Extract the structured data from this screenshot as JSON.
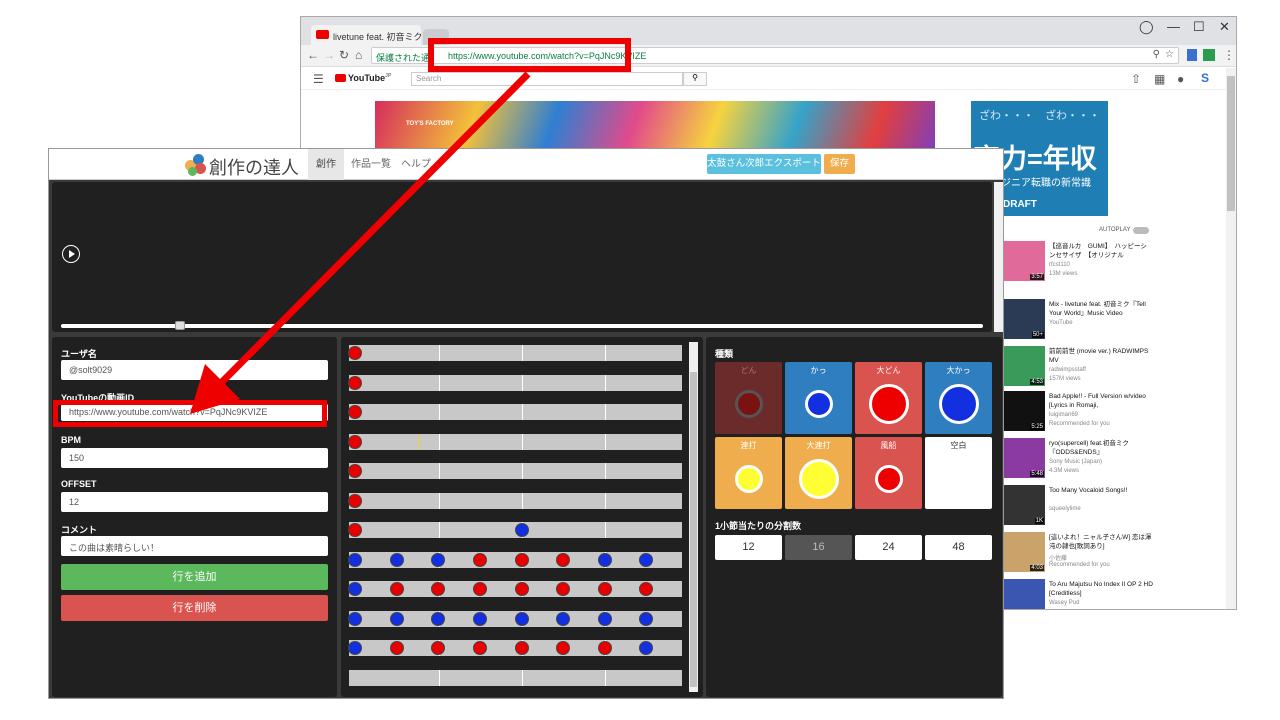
{
  "browser": {
    "tab_title": "livetune feat. 初音ミク『Te",
    "window_controls": [
      "◯",
      "—",
      "☐",
      "✕"
    ],
    "secure_label": "保護された通",
    "url": "https://www.youtube.com/watch?v=PqJNc9KVIZE",
    "search_placeholder": "Search",
    "youtube_logo": "YouTube",
    "youtube_region": "JP",
    "banner_brand": "TOY'S FACTORY",
    "ad": {
      "deco": "ざわ・・・　ざわ・・・",
      "title": "実力=年収",
      "subtitle": "エンジニア転職の新常識",
      "brand": "転職DRAFT"
    },
    "autoplay_label": "AUTOPLAY",
    "recommendations": [
      {
        "title": "【巡音ルカ　GUMI】　ハッピーシンセサイザ　【オリジナル",
        "channel": "rfcst110",
        "meta": "13M views",
        "duration": "3:57",
        "color": "#e06b9a"
      },
      {
        "title": "Mix - livetune feat. 初音ミク『Tell Your World』Music Video",
        "channel": "YouTube",
        "meta": "",
        "duration": "50+",
        "color": "#2b3a55"
      },
      {
        "title": "前前前世 (movie ver.) RADWIMPS MV",
        "channel": "radwimpsstaff",
        "meta": "157M views",
        "duration": "4:53",
        "color": "#3a9a5a"
      },
      {
        "title": "Bad Apple!! - Full Version w/video [Lyrics in Romaji,",
        "channel": "luigiman69",
        "meta": "Recommended for you",
        "duration": "5:25",
        "color": "#111111"
      },
      {
        "title": "ryo(supercell) feat.初音ミク『ODDS&ENDS』",
        "channel": "Sony Music (Japan)",
        "meta": "4.3M views",
        "duration": "5:48",
        "color": "#8a3aa0"
      },
      {
        "title": "Too Many Vocaloid Songs!!",
        "channel": "squeelylime",
        "meta": "",
        "duration": "1K",
        "color": "#333333"
      },
      {
        "title": "[這いよれ！ニャル子さんW] 恋は渾沌の隷也[歌詞あり]",
        "channel": "小佐藤",
        "meta": "Recommended for you",
        "duration": "4:03",
        "color": "#c9a36a"
      },
      {
        "title": "To Aru Majutsu No Index II OP 2 HD [Creditless]",
        "channel": "Wasey Pud",
        "meta": "",
        "duration": "",
        "color": "#3a56b0"
      }
    ]
  },
  "app": {
    "brand": "創作の達人",
    "nav": [
      "創作",
      "作品一覧",
      "ヘルプ"
    ],
    "export_label": "太鼓さん次郎エクスポート",
    "save_label": "保存",
    "form": {
      "user_label": "ユーザ名",
      "user_value": "@solt9029",
      "video_label": "YouTubeの動画ID",
      "video_value": "https://www.youtube.com/watch?v=PqJNc9KVIZE",
      "bpm_label": "BPM",
      "bpm_value": "150",
      "offset_label": "OFFSET",
      "offset_value": "12",
      "comment_label": "コメント",
      "comment_value": "この曲は素晴らしい！",
      "add_row": "行を追加",
      "delete_row": "行を削除"
    },
    "sequencer": {
      "rows": [
        {
          "notes": [
            {
              "pos": 0,
              "t": "don"
            }
          ]
        },
        {
          "notes": [
            {
              "pos": 0,
              "t": "don"
            }
          ]
        },
        {
          "notes": [
            {
              "pos": 0,
              "t": "don"
            }
          ]
        },
        {
          "notes": [
            {
              "pos": 0,
              "t": "don"
            }
          ],
          "marker": 2
        },
        {
          "notes": [
            {
              "pos": 0,
              "t": "don"
            }
          ]
        },
        {
          "notes": [
            {
              "pos": 0,
              "t": "don"
            }
          ]
        },
        {
          "notes": [
            {
              "pos": 0,
              "t": "don"
            },
            {
              "pos": 4,
              "t": "ka"
            }
          ]
        },
        {
          "notes": [
            {
              "pos": 0,
              "t": "ka"
            },
            {
              "pos": 1,
              "t": "ka"
            },
            {
              "pos": 2,
              "t": "ka"
            },
            {
              "pos": 3,
              "t": "don"
            },
            {
              "pos": 4,
              "t": "don"
            },
            {
              "pos": 5,
              "t": "don"
            },
            {
              "pos": 6,
              "t": "ka"
            },
            {
              "pos": 7,
              "t": "ka"
            }
          ]
        },
        {
          "notes": [
            {
              "pos": 0,
              "t": "ka"
            },
            {
              "pos": 1,
              "t": "don"
            },
            {
              "pos": 2,
              "t": "don"
            },
            {
              "pos": 3,
              "t": "don"
            },
            {
              "pos": 4,
              "t": "don"
            },
            {
              "pos": 5,
              "t": "don"
            },
            {
              "pos": 6,
              "t": "don"
            },
            {
              "pos": 7,
              "t": "don"
            }
          ]
        },
        {
          "notes": [
            {
              "pos": 0,
              "t": "ka"
            },
            {
              "pos": 1,
              "t": "ka"
            },
            {
              "pos": 2,
              "t": "ka"
            },
            {
              "pos": 3,
              "t": "ka"
            },
            {
              "pos": 4,
              "t": "ka"
            },
            {
              "pos": 5,
              "t": "ka"
            },
            {
              "pos": 6,
              "t": "ka"
            },
            {
              "pos": 7,
              "t": "ka"
            }
          ]
        },
        {
          "notes": [
            {
              "pos": 0,
              "t": "ka"
            },
            {
              "pos": 1,
              "t": "don"
            },
            {
              "pos": 2,
              "t": "don"
            },
            {
              "pos": 3,
              "t": "don"
            },
            {
              "pos": 4,
              "t": "don"
            },
            {
              "pos": 5,
              "t": "don"
            },
            {
              "pos": 6,
              "t": "don"
            },
            {
              "pos": 7,
              "t": "ka"
            }
          ]
        },
        {
          "notes": []
        }
      ]
    },
    "kinds": {
      "label": "種類",
      "items": [
        {
          "label": "どん",
          "bg": "#6b2b2b",
          "circle": "#7a1212",
          "size": "small",
          "dim": true
        },
        {
          "label": "かっ",
          "bg": "#2f7fc0",
          "circle": "#1230e0",
          "size": "small"
        },
        {
          "label": "大どん",
          "bg": "#d9534f",
          "circle": "#ee0000",
          "size": "big"
        },
        {
          "label": "大かっ",
          "bg": "#2f7fc0",
          "circle": "#1230e0",
          "size": "big"
        },
        {
          "label": "連打",
          "bg": "#f0ad4e",
          "circle": "#ffff33",
          "size": "small"
        },
        {
          "label": "大連打",
          "bg": "#f0ad4e",
          "circle": "#ffff33",
          "size": "big"
        },
        {
          "label": "風船",
          "bg": "#d9534f",
          "circle": "#ee0000",
          "size": "small"
        },
        {
          "label": "空白",
          "bg": "#ffffff",
          "circle": "",
          "size": "none"
        }
      ]
    },
    "divisions": {
      "label": "1小節当たりの分割数",
      "options": [
        "12",
        "16",
        "24",
        "48"
      ],
      "selected": "16"
    }
  }
}
